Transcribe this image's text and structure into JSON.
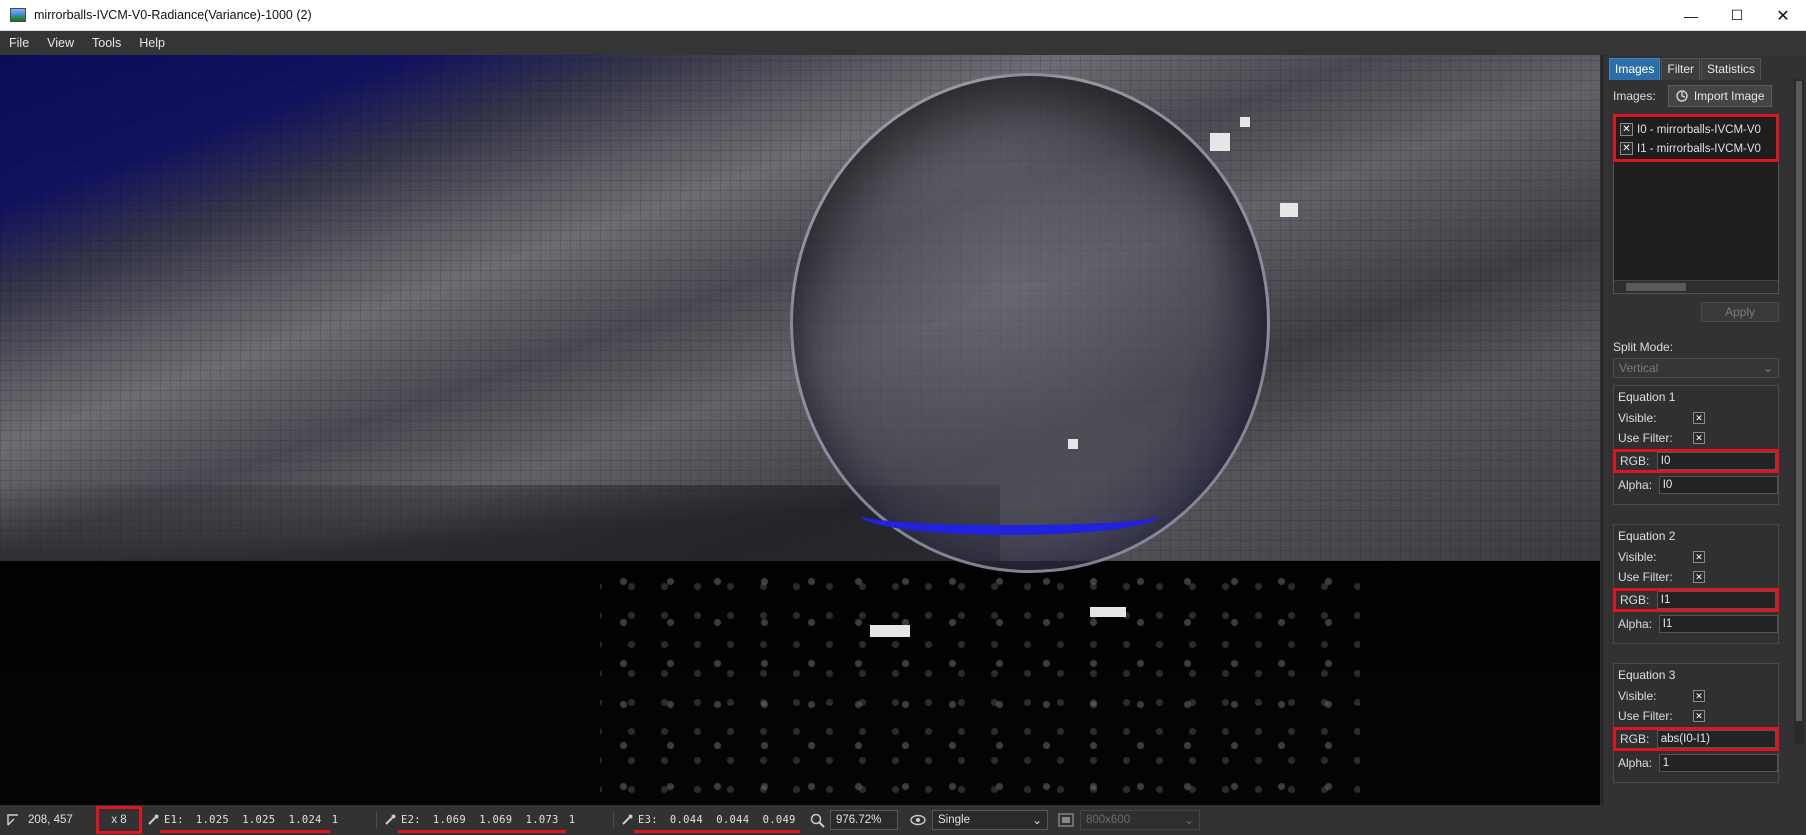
{
  "window": {
    "title": "mirrorballs-IVCM-V0-Radiance(Variance)-1000 (2)",
    "controls": {
      "minimize": "—",
      "maximize": "☐",
      "close": "✕"
    }
  },
  "menu": {
    "items": [
      "File",
      "View",
      "Tools",
      "Help"
    ]
  },
  "panel": {
    "tabs": [
      "Images",
      "Filter",
      "Statistics"
    ],
    "images_label": "Images:",
    "import_button": "Import Image",
    "image_list": [
      "I0 - mirrorballs-IVCM-V0",
      "I1 - mirrorballs-IVCM-V0"
    ],
    "apply_button": "Apply",
    "split_mode_label": "Split Mode:",
    "split_mode_value": "Vertical",
    "equations": [
      {
        "title": "Equation 1",
        "visible_label": "Visible:",
        "use_filter_label": "Use Filter:",
        "rgb_label": "RGB:",
        "rgb_value": "I0",
        "alpha_label": "Alpha:",
        "alpha_value": "I0",
        "visible": true,
        "use_filter": true
      },
      {
        "title": "Equation 2",
        "visible_label": "Visible:",
        "use_filter_label": "Use Filter:",
        "rgb_label": "RGB:",
        "rgb_value": "I1",
        "alpha_label": "Alpha:",
        "alpha_value": "I1",
        "visible": true,
        "use_filter": true
      },
      {
        "title": "Equation 3",
        "visible_label": "Visible:",
        "use_filter_label": "Use Filter:",
        "rgb_label": "RGB:",
        "rgb_value": "abs(I0-I1)",
        "alpha_label": "Alpha:",
        "alpha_value": "1",
        "visible": true,
        "use_filter": true
      }
    ]
  },
  "status": {
    "coords": "208, 457",
    "zoom_factor": "x 8",
    "e1": {
      "label": "E1:",
      "values": "1.025  1.025  1.024",
      "alpha": "1"
    },
    "e2": {
      "label": "E2:",
      "values": "1.069  1.069  1.073",
      "alpha": "1"
    },
    "e3": {
      "label": "E3:",
      "values": "0.044  0.044  0.049"
    },
    "zoom_percent": "976.72%",
    "view_mode": "Single",
    "resolution": "800x600"
  },
  "colors": {
    "accent_red": "#e0141e",
    "tab_active": "#2d6ea8"
  }
}
